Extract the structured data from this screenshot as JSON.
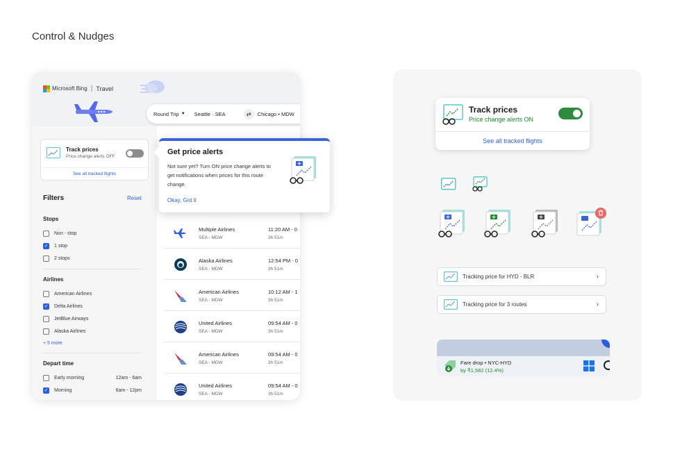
{
  "page": {
    "title": "Control & Nudges"
  },
  "header": {
    "brand": "Microsoft Bing",
    "section": "Travel"
  },
  "search": {
    "trip_type": "Round Trip",
    "from": "Seattle · SEA",
    "to": "Chicago • MDW"
  },
  "track_small": {
    "title": "Track prices",
    "subtitle": "Price change alerts OFF",
    "link": "See all tracked flights"
  },
  "filters": {
    "title": "Filters",
    "reset": "Reset",
    "stops_title": "Stops",
    "stops": [
      {
        "label": "Non - stop",
        "checked": false
      },
      {
        "label": "1 stop",
        "checked": true
      },
      {
        "label": "2 stops",
        "checked": false
      }
    ],
    "airlines_title": "Airlines",
    "airlines": [
      {
        "label": "American Airlines",
        "checked": false
      },
      {
        "label": "Delta Airlines",
        "checked": true
      },
      {
        "label": "JetBlue Airways",
        "checked": false
      },
      {
        "label": "Alaska Airlines",
        "checked": false
      }
    ],
    "more": "+ 5 more",
    "depart_title": "Depart time",
    "depart": [
      {
        "label": "Early morning",
        "time": "12am - 6am",
        "checked": false
      },
      {
        "label": "Morning",
        "time": "6am - 12pm",
        "checked": true
      }
    ]
  },
  "flights": [
    {
      "airline": "Multiple Airlines",
      "route": "SEA - MDW",
      "time": "11:20 AM - 0",
      "duration": "3h 51m",
      "logo": "multi-airline-plane-icon"
    },
    {
      "airline": "Alaska Airlines",
      "route": "SEA - MDW",
      "time": "12:54 PM - 0",
      "duration": "3h 51m",
      "logo": "alaska-airlines-logo"
    },
    {
      "airline": "American Airlines",
      "route": "SEA - MDW",
      "time": "10:12 AM - 1",
      "duration": "3h 51m",
      "logo": "american-airlines-logo"
    },
    {
      "airline": "United Airlines",
      "route": "SEA - MDW",
      "time": "09:54 AM - 0",
      "duration": "3h 51m",
      "logo": "united-airlines-logo"
    },
    {
      "airline": "American Airlines",
      "route": "SEA - MDW",
      "time": "09:54 AM - 0",
      "duration": "3h 51m",
      "logo": "american-airlines-logo"
    },
    {
      "airline": "United Airlines",
      "route": "SEA - MDW",
      "time": "09:54 AM - 0",
      "duration": "3h 51m",
      "logo": "united-airlines-logo"
    }
  ],
  "popover": {
    "title": "Get price alerts",
    "body": "Not sure yet? Turn ON price change alerts to get notifications when prices for this route change.",
    "action": "Okay, Got it"
  },
  "track_big": {
    "title": "Track prices",
    "subtitle": "Price change alerts ON",
    "link": "See all tracked flights"
  },
  "tracking_pills": [
    "Tracking price for HYD - BLR",
    "Tracking price for 3 routes"
  ],
  "toast": {
    "title": "Fare drop • NYC-HYD",
    "detail": "by ₹1,582 (12.4%)"
  },
  "colors": {
    "accent": "#2b5fdc",
    "success": "#2e8b3d",
    "danger": "#e46a6a"
  }
}
